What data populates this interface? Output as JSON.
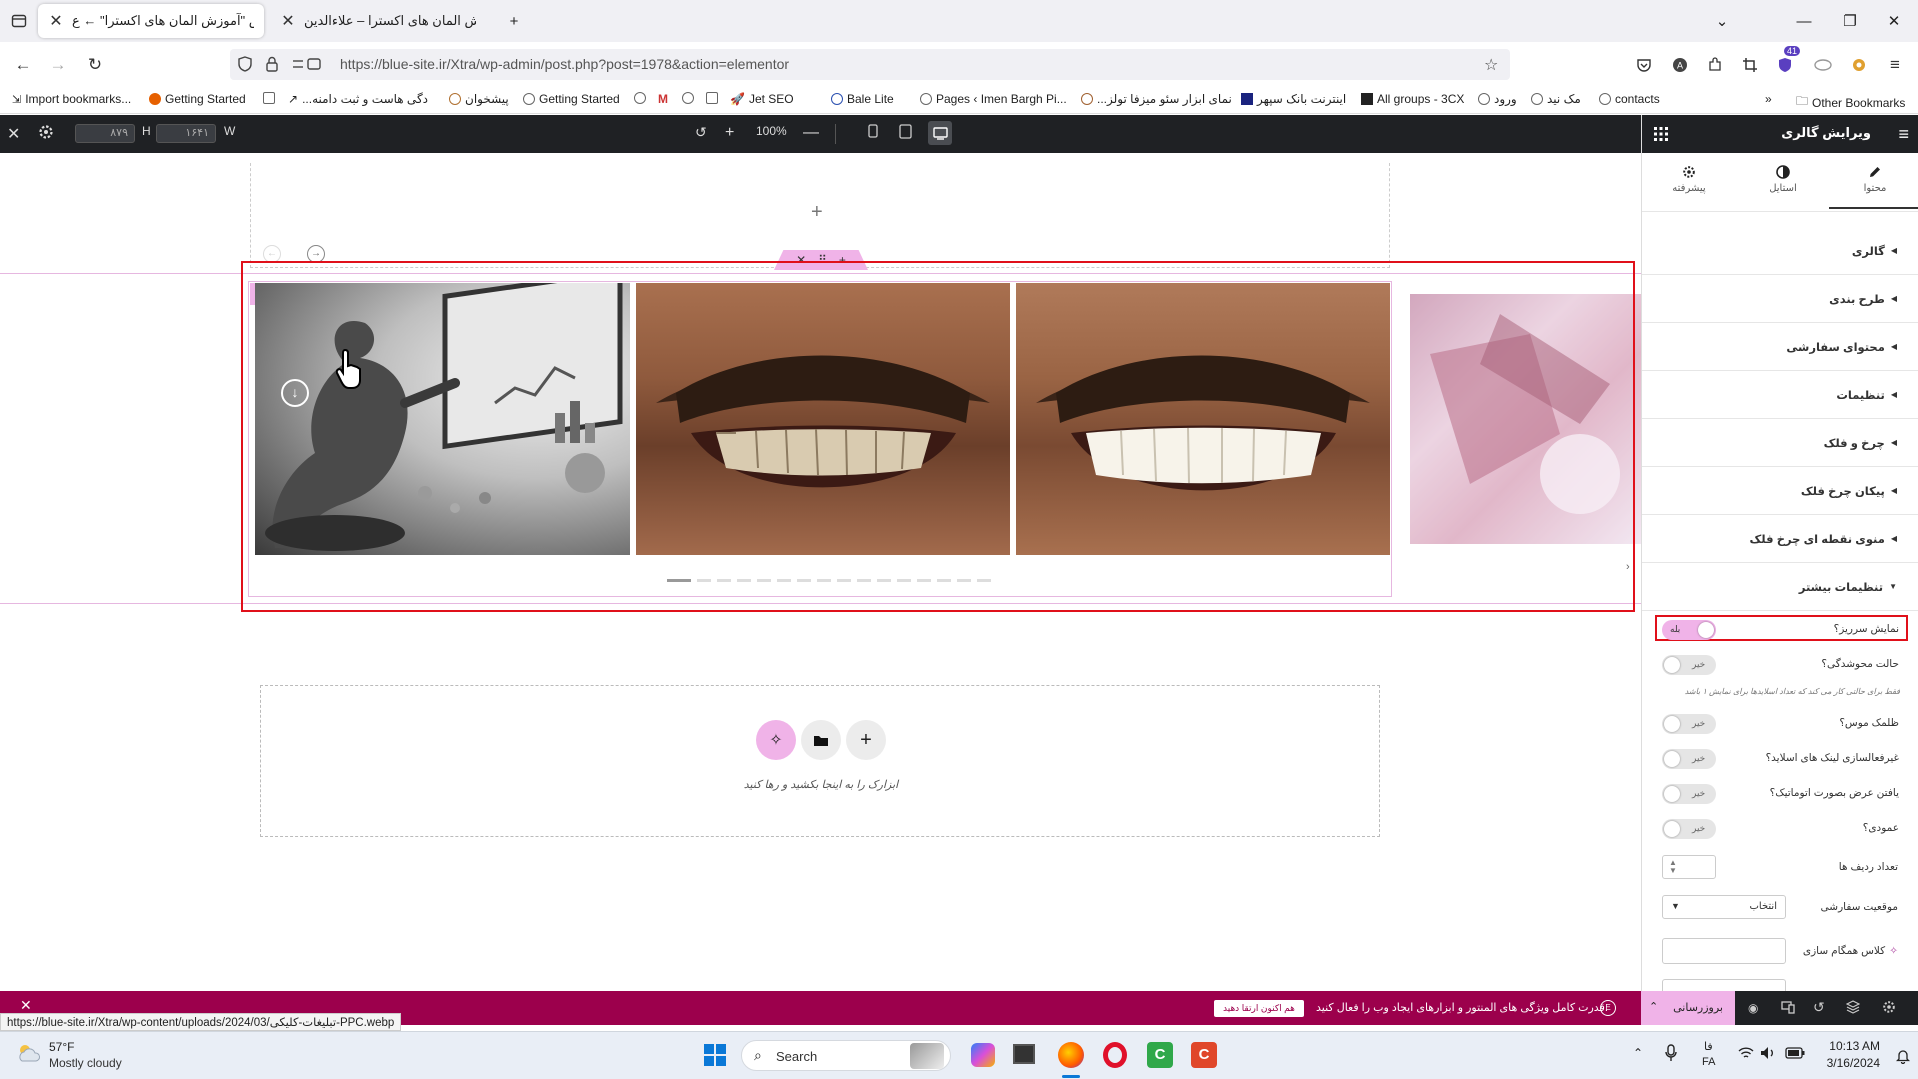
{
  "browser": {
    "tabs": [
      {
        "label": "ویرایش \"آموزش المان های اکسترا\" ← ع",
        "active": true
      },
      {
        "label": "آموزش المان های اکسترا – علاءالدین",
        "active": false
      }
    ],
    "url": "https://blue-site.ir/Xtra/wp-admin/post.php?post=1978&action=elementor",
    "bookmarks": [
      "Import bookmarks...",
      "Getting Started",
      "...دگی هاست و ثبت دامنه",
      "پیشخوان",
      "Getting Started",
      "Jet SEO",
      "Bale Lite",
      "Pages ‹ Imen Bargh Pi...",
      "...نمای ابزار سئو میزفا تولز",
      "اینترنت بانک سپهر",
      "All groups - 3CX",
      "ورود",
      "مک نید",
      "contacts"
    ],
    "other_bookmarks": "Other Bookmarks",
    "notification_count": "41"
  },
  "editor": {
    "width_label": "W",
    "width_value": "۱۶۴۱",
    "height_label": "H",
    "height_value": "۸۷۹",
    "zoom": "100%"
  },
  "canvas": {
    "drop_text": "ابزارک را به اینجا بکشید و رها کنید",
    "slider_dots": 16
  },
  "panel": {
    "title": "ویرایش گالری",
    "tabs": [
      {
        "label": "محتوا",
        "icon": "pencil-icon"
      },
      {
        "label": "استایل",
        "icon": "contrast-icon"
      },
      {
        "label": "پیشرفته",
        "icon": "gear-icon"
      }
    ],
    "sections": [
      "گالری",
      "طرح بندی",
      "محتوای سفارشی",
      "تنظیمات",
      "چرخ و فلک",
      "پیکان چرخ فلک",
      "منوی نقطه ای چرخ فلک",
      "تنظیمات بیشتر"
    ],
    "controls": [
      {
        "label": "نمایش سرریز؟",
        "state": "بله",
        "on": true
      },
      {
        "label": "حالت محوشدگی؟",
        "state": "خیر",
        "on": false
      },
      {
        "label": "ظلمک موس؟",
        "state": "خیر",
        "on": false
      },
      {
        "label": "غیرفعالسازی لینک های اسلاید؟",
        "state": "خیر",
        "on": false
      },
      {
        "label": "یافتن عرض بصورت اتوماتیک؟",
        "state": "خیر",
        "on": false
      },
      {
        "label": "عمودی؟",
        "state": "خیر",
        "on": false
      }
    ],
    "fade_hint": "فقط برای حالتی کار می کند که تعداد اسلایدها برای نمایش ۱ باشد",
    "rows_label": "تعداد ردیف ها",
    "custom_position_label": "موقعیت سفارشی",
    "custom_position_value": "انتخاب",
    "sync_class_label": "کلاس همگام سازی"
  },
  "notice": {
    "text": "قدرت کامل ویژگی های المنتور و ابزارهای ایجاد وب را فعال کنید.",
    "button": "هم اکنون ارتقا دهید",
    "update_button": "بروزرسانی"
  },
  "status_url": "https://blue-site.ir/Xtra/wp-content/uploads/2024/03/تبلیغات-کلیکی-PPC.webp",
  "taskbar": {
    "weather_temp": "57°F",
    "weather_desc": "Mostly cloudy",
    "search_placeholder": "Search",
    "lang_top": "فا",
    "lang_bottom": "FA",
    "time": "10:13 AM",
    "date": "3/16/2024"
  },
  "colors": {
    "accent_pink": "#f0b3e8",
    "notice_bg": "#9c004c",
    "dark_bar": "#1f2124",
    "highlight_red": "#e0101a"
  }
}
